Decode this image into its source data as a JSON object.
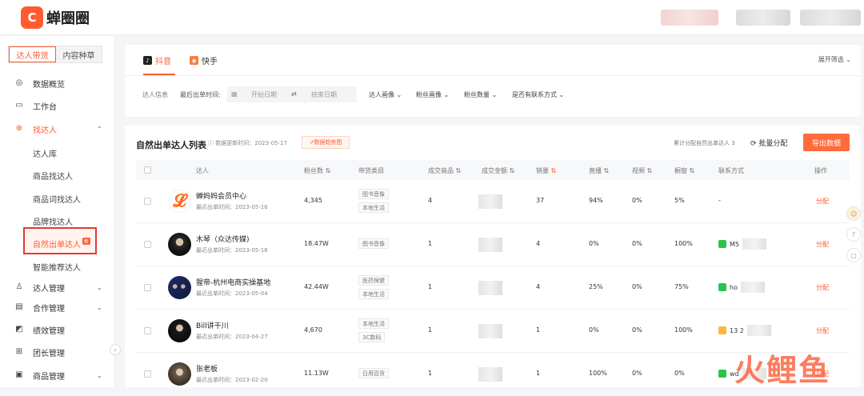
{
  "app": {
    "logo_text": "蝉圈圈"
  },
  "sidebar": {
    "tabs": [
      "达人带货",
      "内容种草"
    ],
    "nav": [
      {
        "label": "数据概览",
        "icon": "dashboard-icon"
      },
      {
        "label": "工作台",
        "icon": "monitor-icon"
      },
      {
        "label": "找达人",
        "icon": "user-search-icon"
      },
      {
        "label": "达人管理",
        "icon": "users-icon"
      },
      {
        "label": "合作管理",
        "icon": "clipboard-icon"
      },
      {
        "label": "绩效管理",
        "icon": "chart-icon"
      },
      {
        "label": "团长管理",
        "icon": "team-icon"
      },
      {
        "label": "商品管理",
        "icon": "box-icon"
      }
    ],
    "sub": [
      "达人库",
      "商品找达人",
      "商品词找达人",
      "品牌找达人",
      "自然出单达人",
      "智能推荐达人"
    ],
    "new_badge": "新"
  },
  "platforms": [
    "抖音",
    "快手"
  ],
  "filters": {
    "expand": "展开筛选",
    "info_label": "达人信息",
    "date_label": "最后出单时间:",
    "start": "开始日期",
    "end": "结束日期",
    "dropdowns": [
      "达人画像",
      "粉丝画像",
      "粉丝数量",
      "是否有联系方式"
    ]
  },
  "list": {
    "title": "自然出单达人列表",
    "update": "数据更新时间：2023-05-17",
    "heat": "数据趋势图",
    "count": "累计分配自然出单达人 3",
    "batch": "批量分配",
    "export": "导出数据",
    "headers": [
      "达人",
      "粉丝数",
      "带货类目",
      "成交商品",
      "成交金额",
      "销量",
      "直播",
      "视频",
      "橱窗",
      "联系方式",
      "操作"
    ]
  },
  "rows": [
    {
      "name": "蝉妈妈会员中心",
      "last": "最近出单时间：2023-05-16",
      "fans": "4,345",
      "tags": [
        "图书音像",
        "本地生活"
      ],
      "goods": "4",
      "sales": "37",
      "live": "94%",
      "video": "0%",
      "window": "5%",
      "contact": "-",
      "op": "分配",
      "wx": false
    },
    {
      "name": "木琴（众达传媒)",
      "last": "最近出单时间：2023-05-16",
      "fans": "18.47W",
      "tags": [
        "图书音像"
      ],
      "goods": "1",
      "sales": "4",
      "live": "0%",
      "video": "0%",
      "window": "100%",
      "contact": "M5",
      "op": "分配",
      "wx": true
    },
    {
      "name": "猩帝-杭州电商实操基地",
      "last": "最近出单时间：2023-05-04",
      "fans": "42.44W",
      "tags": [
        "医药保健",
        "本地生活"
      ],
      "goods": "1",
      "sales": "4",
      "live": "25%",
      "video": "0%",
      "window": "75%",
      "contact": "ho",
      "op": "分配",
      "wx": true
    },
    {
      "name": "Bill讲干川",
      "last": "最近出单时间：2023-04-27",
      "fans": "4,670",
      "tags": [
        "本地生活",
        "3C数码"
      ],
      "goods": "1",
      "sales": "1",
      "live": "0%",
      "video": "0%",
      "window": "100%",
      "contact": "13 2",
      "op": "分配",
      "wx": false
    },
    {
      "name": "张老板",
      "last": "最近出单时间：2023-02-20",
      "fans": "11.13W",
      "tags": [
        "日用百货"
      ],
      "goods": "1",
      "sales": "1",
      "live": "100%",
      "video": "0%",
      "window": "0%",
      "contact": "wd",
      "op": "分配",
      "wx": true
    }
  ],
  "watermark": "火鲤鱼"
}
